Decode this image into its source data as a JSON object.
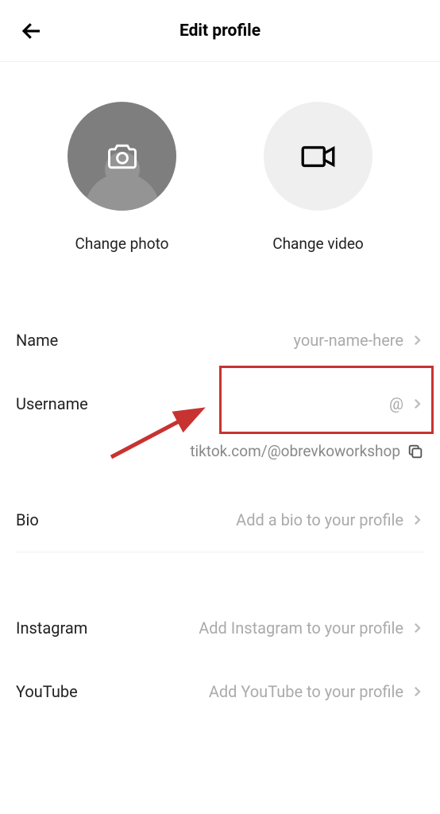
{
  "header": {
    "title": "Edit profile"
  },
  "media": {
    "photo_label": "Change photo",
    "video_label": "Change video"
  },
  "fields": {
    "name_label": "Name",
    "name_value": "your-name-here",
    "username_label": "Username",
    "username_value": "@",
    "url": "tiktok.com/@obrevkoworkshop",
    "bio_label": "Bio",
    "bio_value": "Add a bio to your profile",
    "instagram_label": "Instagram",
    "instagram_value": "Add Instagram to your profile",
    "youtube_label": "YouTube",
    "youtube_value": "Add YouTube to your profile"
  },
  "annotation": {
    "highlight_color": "#c73331"
  }
}
